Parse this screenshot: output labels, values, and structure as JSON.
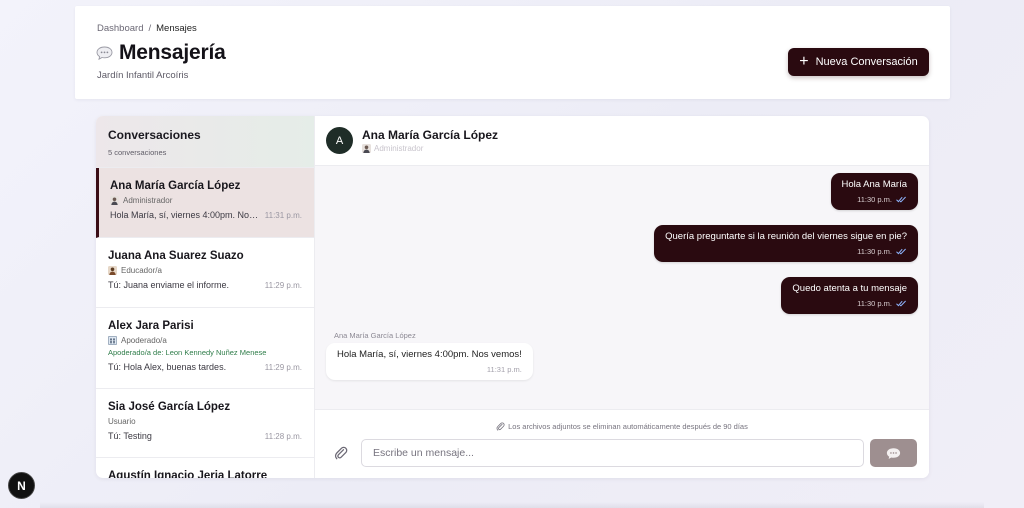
{
  "header": {
    "breadcrumb": [
      "Dashboard",
      "/",
      "Mensajes"
    ],
    "title": "Mensajería",
    "subtitle": "Jardín Infantil Arcoíris",
    "new_button_label": "Nueva Conversación",
    "title_icon": "chat-bubble-icon"
  },
  "sidebar": {
    "title": "Conversaciones",
    "count": "5 conversaciones",
    "conversations": [
      {
        "name": "Ana María García López",
        "role": "Administrador",
        "role_icon": "person-icon",
        "preview": "Hola María, sí, viernes 4:00pm. Nos vemos!",
        "time": "11:31 p.m."
      },
      {
        "name": "Juana Ana Suarez Suazo",
        "role": "Educador/a",
        "role_icon": "teacher-icon",
        "preview": "Tú: Juana enviame el informe.",
        "time": "11:29 p.m."
      },
      {
        "name": "Alex Jara Parisi",
        "role": "Apoderado/a",
        "role_icon": "family-icon",
        "guardian": "Apoderado/a de: Leon Kennedy Nuñez Menese",
        "preview": "Tú: Hola Alex, buenas tardes.",
        "time": "11:29 p.m."
      },
      {
        "name": "Sia José García López",
        "role": "Usuario",
        "preview": "Tú: Testing",
        "time": "11:28 p.m."
      },
      {
        "name": "Agustín Ignacio Jeria Latorre"
      }
    ]
  },
  "chat": {
    "contact_initial": "A",
    "contact_name": "Ana María García López",
    "contact_role": "Administrador",
    "messages_out": [
      {
        "text": "Hola Ana María",
        "time": "11:30 p.m."
      },
      {
        "text": "Quería preguntarte si la reunión del viernes sigue en pie?",
        "time": "11:30 p.m."
      },
      {
        "text": "Quedo atenta a tu mensaje",
        "time": "11:30 p.m."
      }
    ],
    "incoming": {
      "sender": "Ana María García López",
      "text": "Hola María, sí, viernes 4:00pm. Nos vemos!",
      "time": "11:31 p.m.",
      "reaction": "👍"
    },
    "attachments_note": "Los archivos adjuntos se eliminan automáticamente después de 90 días",
    "input_placeholder": "Escribe un mensaje..."
  },
  "badge": {
    "label": "N"
  },
  "colors": {
    "primary": "#2a0a10",
    "active_bg": "#ece2e2",
    "guardian_text": "#2f7d4a",
    "send_disabled": "#9e8f90"
  }
}
